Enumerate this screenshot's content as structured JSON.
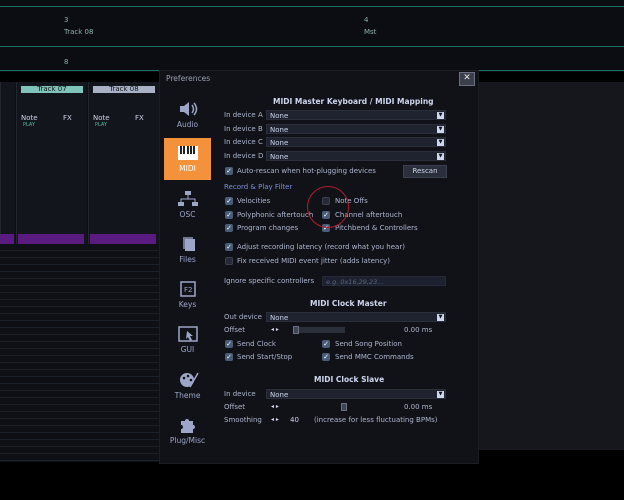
{
  "background": {
    "track_num_3": "3",
    "track_num_4": "4",
    "track_name_3": "Track 08",
    "track_name_4": "Mst",
    "track_num_8": "8",
    "strip1_name": "Track 07",
    "strip2_name": "Track 08",
    "note_label": "Note",
    "fx_label": "FX",
    "play_label": "PLAY"
  },
  "dialog": {
    "title": "Preferences",
    "close_glyph": "✕"
  },
  "sidebar": {
    "items": [
      {
        "label": "Audio",
        "icon": "speaker-icon"
      },
      {
        "label": "MIDI",
        "icon": "piano-keys-icon",
        "active": true
      },
      {
        "label": "OSC",
        "icon": "network-icon"
      },
      {
        "label": "Files",
        "icon": "files-icon"
      },
      {
        "label": "Keys",
        "icon": "keyboard-key-icon"
      },
      {
        "label": "GUI",
        "icon": "cursor-window-icon"
      },
      {
        "label": "Theme",
        "icon": "palette-icon"
      },
      {
        "label": "Plug/Misc",
        "icon": "puzzle-icon"
      }
    ]
  },
  "midi_master": {
    "title": "MIDI Master Keyboard / MIDI Mapping",
    "devices": [
      {
        "label": "In device A",
        "value": "None"
      },
      {
        "label": "In device B",
        "value": "None"
      },
      {
        "label": "In device C",
        "value": "None"
      },
      {
        "label": "In device D",
        "value": "None"
      }
    ],
    "auto_rescan": "Auto-rescan when hot-plugging devices",
    "rescan_button": "Rescan"
  },
  "record_play": {
    "title": "Record & Play Filter",
    "velocities": "Velocities",
    "note_offs": "Note Offs",
    "poly_aftertouch": "Polyphonic aftertouch",
    "channel_aftertouch": "Channel aftertouch",
    "program_changes": "Program changes",
    "pitchbend": "Pitchbend & Controllers",
    "adjust_latency": "Adjust recording latency (record what you hear)",
    "fix_jitter": "Fix received MIDI event jitter (adds latency)",
    "ignore_controllers": "Ignore specific controllers",
    "ignore_placeholder": "e.g. 0x16,29,23..."
  },
  "clock_master": {
    "title": "MIDI Clock Master",
    "out_device_label": "Out device",
    "out_device_value": "None",
    "offset_label": "Offset",
    "offset_value": "0.00 ms",
    "send_clock": "Send Clock",
    "send_song_position": "Send Song Position",
    "send_start_stop": "Send Start/Stop",
    "send_mmc": "Send MMC Commands"
  },
  "clock_slave": {
    "title": "MIDI Clock Slave",
    "in_device_label": "In device",
    "in_device_value": "None",
    "offset_label": "Offset",
    "offset_value": "0.00 ms",
    "smoothing_label": "Smoothing",
    "smoothing_value": "40",
    "smoothing_hint": "(increase for less fluctuating BPMs)"
  },
  "colors": {
    "accent": "#f4923c",
    "annotation_circle": "#b01c2e",
    "checkbox": "#4a5d78"
  }
}
